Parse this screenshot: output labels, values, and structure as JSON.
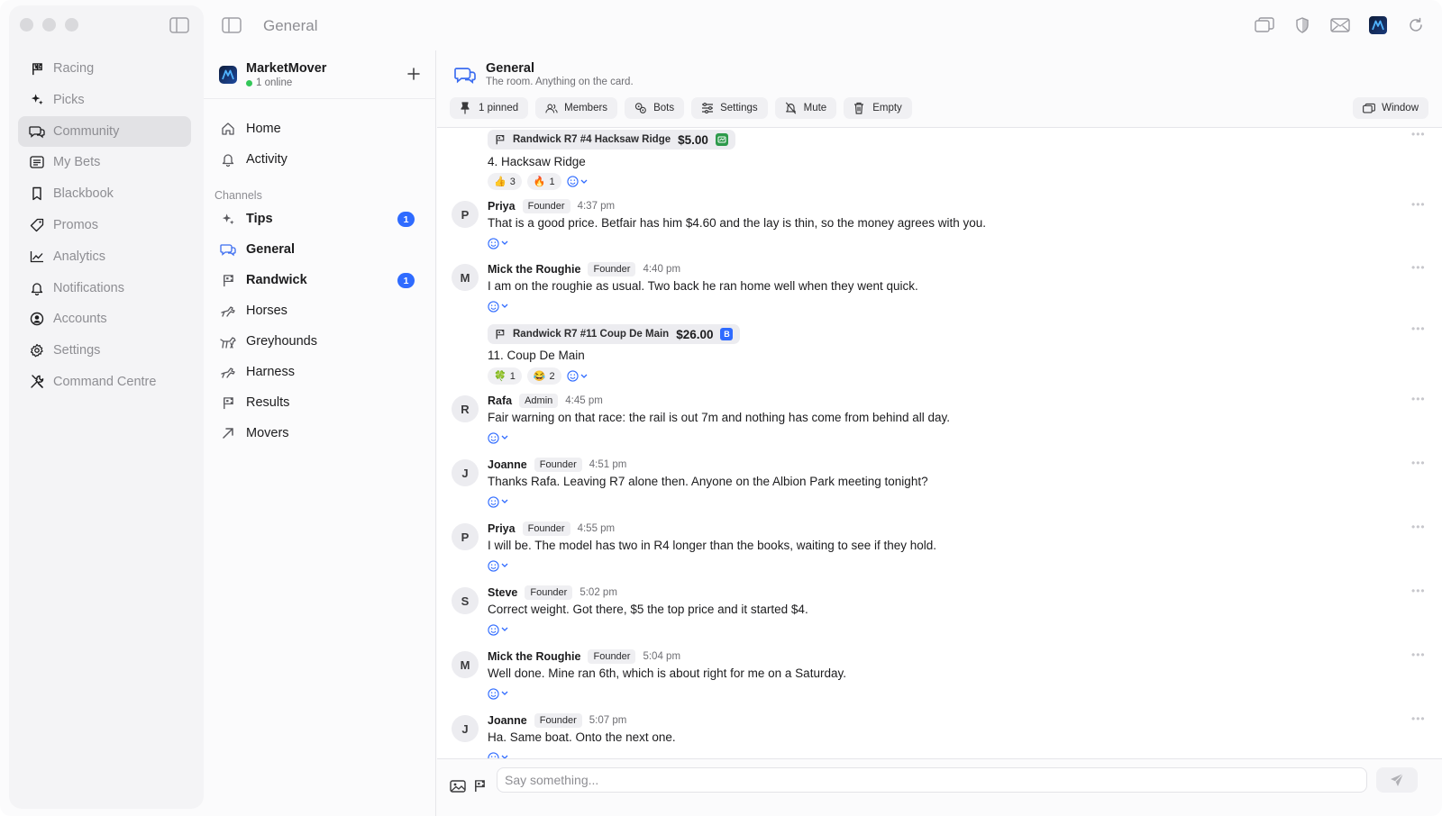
{
  "window": {
    "title": "General"
  },
  "rail": {
    "items": [
      {
        "label": "Racing",
        "icon": "flag-icon"
      },
      {
        "label": "Picks",
        "icon": "sparkle-icon"
      },
      {
        "label": "Community",
        "icon": "chat-bubbles-icon",
        "active": true
      },
      {
        "label": "My Bets",
        "icon": "list-icon"
      },
      {
        "label": "Blackbook",
        "icon": "bookmark-icon"
      },
      {
        "label": "Promos",
        "icon": "tag-icon"
      },
      {
        "label": "Analytics",
        "icon": "chart-line-icon"
      },
      {
        "label": "Notifications",
        "icon": "bell-icon"
      },
      {
        "label": "Accounts",
        "icon": "user-circle-icon"
      },
      {
        "label": "Settings",
        "icon": "gear-icon"
      },
      {
        "label": "Command Centre",
        "icon": "tools-icon"
      }
    ]
  },
  "workspace": {
    "name": "MarketMover",
    "online": "1 online",
    "logo_letter": "M"
  },
  "channels": {
    "top": [
      {
        "label": "Home",
        "icon": "home-icon"
      },
      {
        "label": "Activity",
        "icon": "bell-icon"
      }
    ],
    "section_label": "Channels",
    "items": [
      {
        "label": "Tips",
        "icon": "sparkle-icon",
        "badge": "1",
        "bold": true
      },
      {
        "label": "General",
        "icon": "chat-bubbles-icon",
        "bold": true
      },
      {
        "label": "Randwick",
        "icon": "flag-icon",
        "badge": "1",
        "bold": true
      },
      {
        "label": "Horses",
        "icon": "horse-icon"
      },
      {
        "label": "Greyhounds",
        "icon": "dog-icon"
      },
      {
        "label": "Harness",
        "icon": "horse-icon"
      },
      {
        "label": "Results",
        "icon": "flag-icon"
      },
      {
        "label": "Movers",
        "icon": "arrow-up-right-icon"
      }
    ]
  },
  "room": {
    "title": "General",
    "subtitle": "The room. Anything on the card.",
    "toolbar": [
      {
        "label": "1 pinned",
        "icon": "pin-icon"
      },
      {
        "label": "Members",
        "icon": "members-icon"
      },
      {
        "label": "Bots",
        "icon": "bots-icon"
      },
      {
        "label": "Settings",
        "icon": "sliders-icon"
      },
      {
        "label": "Mute",
        "icon": "bell-off-icon"
      },
      {
        "label": "Empty",
        "icon": "trash-icon"
      }
    ],
    "window_button": "Window"
  },
  "messages": {
    "card1": {
      "title": "Randwick R7 #4 Hacksaw Ridge",
      "price": "$5.00",
      "bookie_color": "#2e9a4b",
      "bookie_letter": "▪",
      "text": "4. Hacksaw Ridge",
      "reactions": [
        {
          "emoji": "👍",
          "count": "3"
        },
        {
          "emoji": "🔥",
          "count": "1"
        }
      ]
    },
    "m1": {
      "avatar": "P",
      "name": "Priya",
      "role": "Founder",
      "time": "4:37 pm",
      "text": "That is a good price. Betfair has him $4.60 and the lay is thin, so the money agrees with you."
    },
    "m2": {
      "avatar": "M",
      "name": "Mick the Roughie",
      "role": "Founder",
      "time": "4:40 pm",
      "text": "I am on the roughie as usual. Two back he ran home well when they went quick."
    },
    "card2": {
      "title": "Randwick R7 #11 Coup De Main",
      "price": "$26.00",
      "bookie_color": "#2f6bff",
      "bookie_letter": "B",
      "text": "11. Coup De Main",
      "reactions": [
        {
          "emoji": "🍀",
          "count": "1"
        },
        {
          "emoji": "😂",
          "count": "2"
        }
      ]
    },
    "m3": {
      "avatar": "R",
      "name": "Rafa",
      "role": "Admin",
      "time": "4:45 pm",
      "text": "Fair warning on that race: the rail is out 7m and nothing has come from behind all day."
    },
    "m4": {
      "avatar": "J",
      "name": "Joanne",
      "role": "Founder",
      "time": "4:51 pm",
      "text": "Thanks Rafa. Leaving R7 alone then. Anyone on the Albion Park meeting tonight?"
    },
    "m5": {
      "avatar": "P",
      "name": "Priya",
      "role": "Founder",
      "time": "4:55 pm",
      "text": "I will be. The model has two in R4 longer than the books, waiting to see if they hold."
    },
    "m6": {
      "avatar": "S",
      "name": "Steve",
      "role": "Founder",
      "time": "5:02 pm",
      "text": "Correct weight. Got there, $5 the top price and it started $4."
    },
    "m7": {
      "avatar": "M",
      "name": "Mick the Roughie",
      "role": "Founder",
      "time": "5:04 pm",
      "text": "Well done. Mine ran 6th, which is about right for me on a Saturday."
    },
    "m8": {
      "avatar": "J",
      "name": "Joanne",
      "role": "Founder",
      "time": "5:07 pm",
      "text": "Ha. Same boat. Onto the next one."
    }
  },
  "composer": {
    "placeholder": "Say something..."
  }
}
